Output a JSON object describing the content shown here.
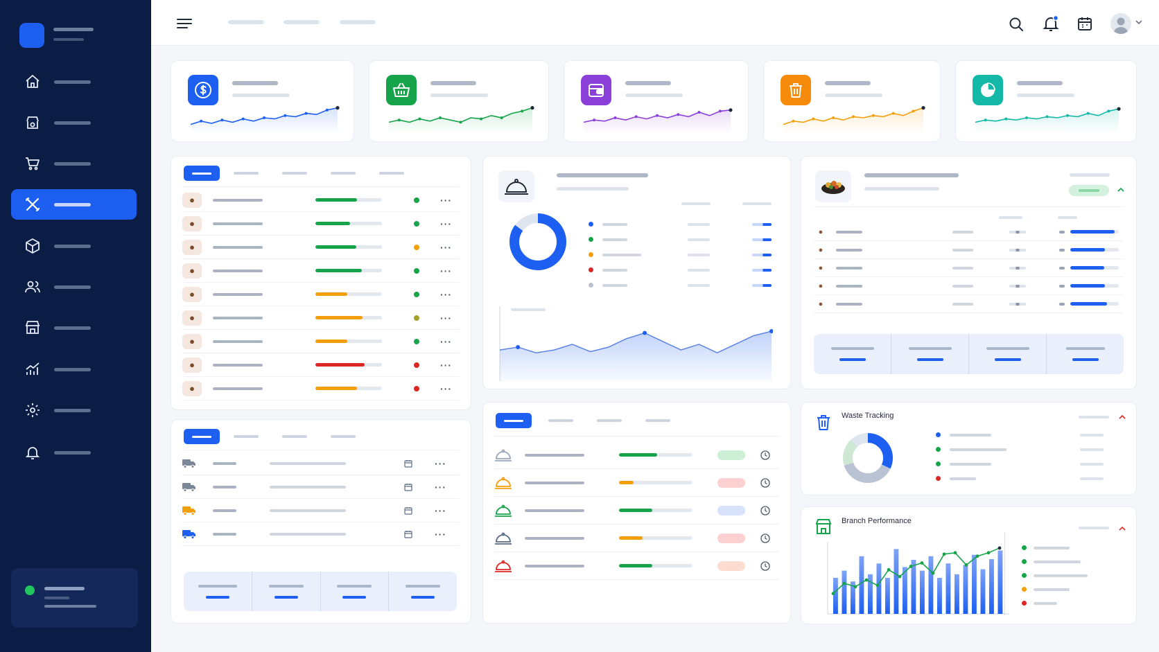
{
  "widgets": {
    "waste_tracking": {
      "title": "Waste Tracking",
      "legend": [
        {
          "color": "#1d5ff0"
        },
        {
          "color": "#16a34a"
        },
        {
          "color": "#16a34a"
        },
        {
          "color": "#dc2626"
        }
      ],
      "donut": [
        0.32,
        0.38,
        0.18,
        0.12
      ]
    },
    "branch_performance": {
      "title": "Branch Performance",
      "legend": [
        {
          "color": "#16a34a"
        },
        {
          "color": "#16a34a"
        },
        {
          "color": "#16a34a"
        },
        {
          "color": "#f59e0b"
        },
        {
          "color": "#dc2626"
        }
      ]
    }
  },
  "colors": {
    "sidebar_bg": "#0b1d45",
    "accent": "#1d5ff0",
    "green": "#16a34a",
    "orange": "#f59e0b",
    "red": "#dc2626",
    "purple": "#8b3fd9",
    "teal": "#14b8a6"
  },
  "icons": {
    "sidebar": [
      "home-icon",
      "store-gear-icon",
      "cart-icon",
      "utensils-icon",
      "box-icon",
      "users-icon",
      "storefront-icon",
      "analytics-icon",
      "gear-icon",
      "bell-icon"
    ],
    "kpis": [
      "dollar-icon",
      "basket-icon",
      "wallet-icon",
      "trash-icon",
      "pie-chart-icon"
    ],
    "topbar": [
      "menu-icon",
      "search-icon",
      "notification-bell-icon",
      "calendar-icon",
      "avatar"
    ]
  },
  "kpis": [
    {
      "color": "#1d5ff0",
      "trend": [
        0.2,
        0.35,
        0.25,
        0.4,
        0.3,
        0.45,
        0.35,
        0.5,
        0.45,
        0.6,
        0.55,
        0.7,
        0.65,
        0.85,
        0.95
      ]
    },
    {
      "color": "#16a34a",
      "trend": [
        0.3,
        0.4,
        0.3,
        0.45,
        0.35,
        0.5,
        0.4,
        0.3,
        0.5,
        0.45,
        0.6,
        0.5,
        0.7,
        0.8,
        0.95
      ]
    },
    {
      "color": "#8b3fd9",
      "trend": [
        0.3,
        0.4,
        0.35,
        0.5,
        0.4,
        0.55,
        0.45,
        0.6,
        0.5,
        0.65,
        0.55,
        0.75,
        0.6,
        0.8,
        0.85
      ]
    },
    {
      "color": "#f59e0b",
      "trend": [
        0.2,
        0.35,
        0.3,
        0.45,
        0.35,
        0.5,
        0.4,
        0.55,
        0.5,
        0.6,
        0.55,
        0.7,
        0.6,
        0.8,
        0.95
      ]
    },
    {
      "color": "#14b8a6",
      "trend": [
        0.3,
        0.4,
        0.35,
        0.45,
        0.4,
        0.5,
        0.45,
        0.55,
        0.5,
        0.6,
        0.55,
        0.7,
        0.6,
        0.8,
        0.9
      ]
    }
  ],
  "inventory_rows": [
    {
      "icon": "meat-icon",
      "fill": 0.62,
      "bar": "#16a34a",
      "status": "#16a34a"
    },
    {
      "icon": "chicken-icon",
      "fill": 0.52,
      "bar": "#16a34a",
      "status": "#16a34a"
    },
    {
      "icon": "fish-icon",
      "fill": 0.61,
      "bar": "#16a34a",
      "status": "#f59e0b"
    },
    {
      "icon": "cheese-icon",
      "fill": 0.7,
      "bar": "#16a34a",
      "status": "#16a34a"
    },
    {
      "icon": "vegetable-icon",
      "fill": 0.48,
      "bar": "#f59e0b",
      "status": "#16a34a"
    },
    {
      "icon": "tomato-icon",
      "fill": 0.71,
      "bar": "#f59e0b",
      "status": "#a3a32a"
    },
    {
      "icon": "onion-icon",
      "fill": 0.48,
      "bar": "#f59e0b",
      "status": "#16a34a"
    },
    {
      "icon": "sack-icon",
      "fill": 0.74,
      "bar": "#dc2626",
      "status": "#dc2626"
    },
    {
      "icon": "spice-icon",
      "fill": 0.62,
      "bar": "#f59e0b",
      "status": "#dc2626"
    }
  ],
  "delivery_rows": [
    {
      "icon": "truck-icon",
      "color": "#7b8699"
    },
    {
      "icon": "truck-icon",
      "color": "#7b8699"
    },
    {
      "icon": "truck-icon",
      "color": "#f59e0b"
    },
    {
      "icon": "truck-icon",
      "color": "#1d5ff0"
    }
  ],
  "sales_mix": {
    "donut": [
      0.85,
      0.15
    ],
    "legend": [
      {
        "color": "#1d5ff0"
      },
      {
        "color": "#16a34a"
      },
      {
        "color": "#f59e0b"
      },
      {
        "color": "#dc2626"
      },
      {
        "color": "#b8c1cf"
      }
    ],
    "trend": [
      0.45,
      0.5,
      0.4,
      0.45,
      0.55,
      0.42,
      0.5,
      0.65,
      0.75,
      0.6,
      0.45,
      0.55,
      0.4,
      0.55,
      0.7,
      0.78
    ]
  },
  "recipe_rows": [
    {
      "icon": "meat-icon",
      "fill": 0.92
    },
    {
      "icon": "oil-icon",
      "fill": 0.72
    },
    {
      "icon": "herb-icon",
      "fill": 0.7
    },
    {
      "icon": "bread-icon",
      "fill": 0.72
    },
    {
      "icon": "egg-icon",
      "fill": 0.76
    }
  ],
  "orders_rows": [
    {
      "color": "#9aa7bb",
      "fill": 0.52,
      "bar": "#16a34a",
      "pill": "#ccefd6"
    },
    {
      "color": "#f59e0b",
      "fill": 0.2,
      "bar": "#f59e0b",
      "pill": "#fbd0d0"
    },
    {
      "color": "#16a34a",
      "fill": 0.45,
      "bar": "#16a34a",
      "pill": "#d8e3fb"
    },
    {
      "color": "#5b6b85",
      "fill": 0.32,
      "bar": "#f59e0b",
      "pill": "#fbd0d0"
    },
    {
      "color": "#dc2626",
      "fill": 0.45,
      "bar": "#16a34a",
      "pill": "#fcdcd0"
    }
  ],
  "branch_bars": [
    0.5,
    0.6,
    0.45,
    0.8,
    0.55,
    0.7,
    0.5,
    0.9,
    0.65,
    0.75,
    0.6,
    0.8,
    0.5,
    0.7,
    0.55,
    0.68,
    0.82,
    0.62,
    0.76,
    0.88
  ],
  "branch_line": [
    0.3,
    0.45,
    0.4,
    0.5,
    0.42,
    0.65,
    0.55,
    0.7,
    0.75,
    0.6,
    0.88,
    0.9,
    0.72,
    0.85,
    0.9,
    0.97
  ]
}
